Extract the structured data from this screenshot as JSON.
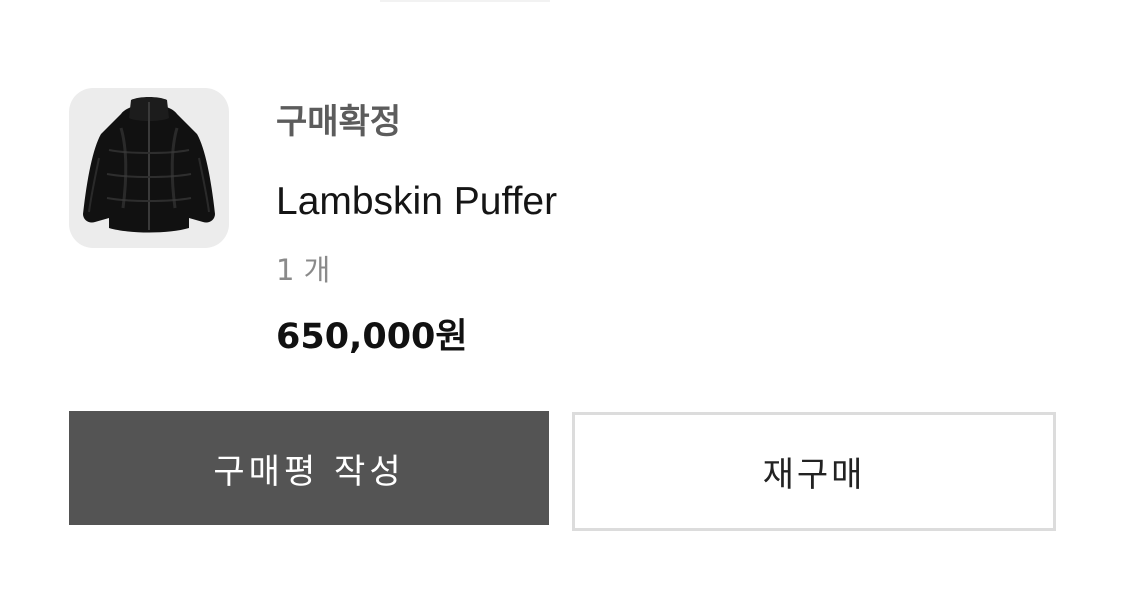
{
  "order_item": {
    "status": "구매확정",
    "product_name": "Lambskin Puffer",
    "quantity": "1 개",
    "price": "650,000원",
    "thumbnail": "black-leather-puffer-jacket"
  },
  "actions": {
    "write_review_label": "구매평 작성",
    "rebuy_label": "재구매"
  },
  "colors": {
    "primary_button": "#545454",
    "secondary_button_border": "#dcdcdc",
    "status_text": "#5c5c5c",
    "quantity_text": "#8a8a8a",
    "thumbnail_bg": "#ececec"
  }
}
